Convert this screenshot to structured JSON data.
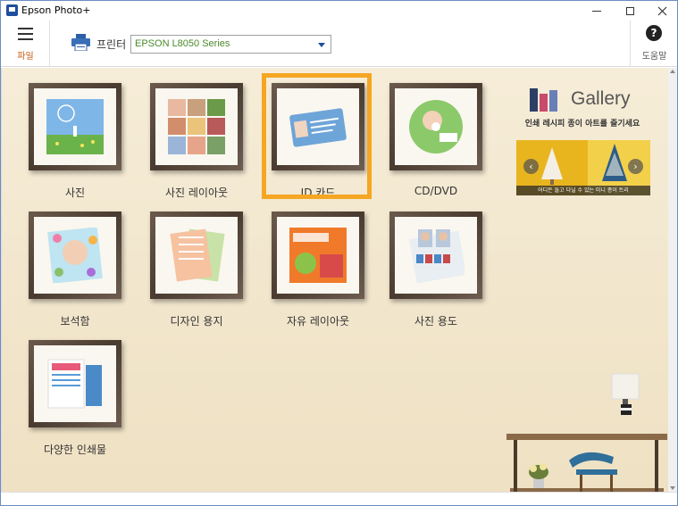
{
  "window": {
    "title": "Epson Photo+",
    "icons": {
      "app": "epson-app-icon",
      "minimize": "minimize-icon",
      "maximize": "maximize-icon",
      "close": "close-icon"
    }
  },
  "toolbar": {
    "menu_label": "파일",
    "printer_label": "프린터",
    "printer_value": "EPSON L8050 Series",
    "help_label": "도움말",
    "help_glyph": "?",
    "icons": {
      "menu": "hamburger-icon",
      "printer": "printer-icon",
      "dropdown": "chevron-down-icon",
      "help": "help-icon"
    }
  },
  "tiles": [
    {
      "label": "사진"
    },
    {
      "label": "사진 레이아웃"
    },
    {
      "label": "ID 카드",
      "selected": true
    },
    {
      "label": "CD/DVD"
    },
    {
      "label": "보석함"
    },
    {
      "label": "디자인 용지"
    },
    {
      "label": "자유 레이아웃"
    },
    {
      "label": "사진 용도"
    },
    {
      "label": "다양한 인쇄물"
    }
  ],
  "gallery": {
    "title": "Gallery",
    "subtitle": "인쇄 레시피 종이 아트를 즐기세요",
    "carousel_caption": "어디든 들고 다닐 수 있는 미니 종이 트리",
    "prev_glyph": "‹",
    "next_glyph": "›",
    "icons": {
      "prev": "chevron-left-icon",
      "next": "chevron-right-icon"
    }
  },
  "colors": {
    "selection": "#f5a623",
    "menu_label": "#c55a11",
    "printer_value": "#4a8a2a"
  }
}
